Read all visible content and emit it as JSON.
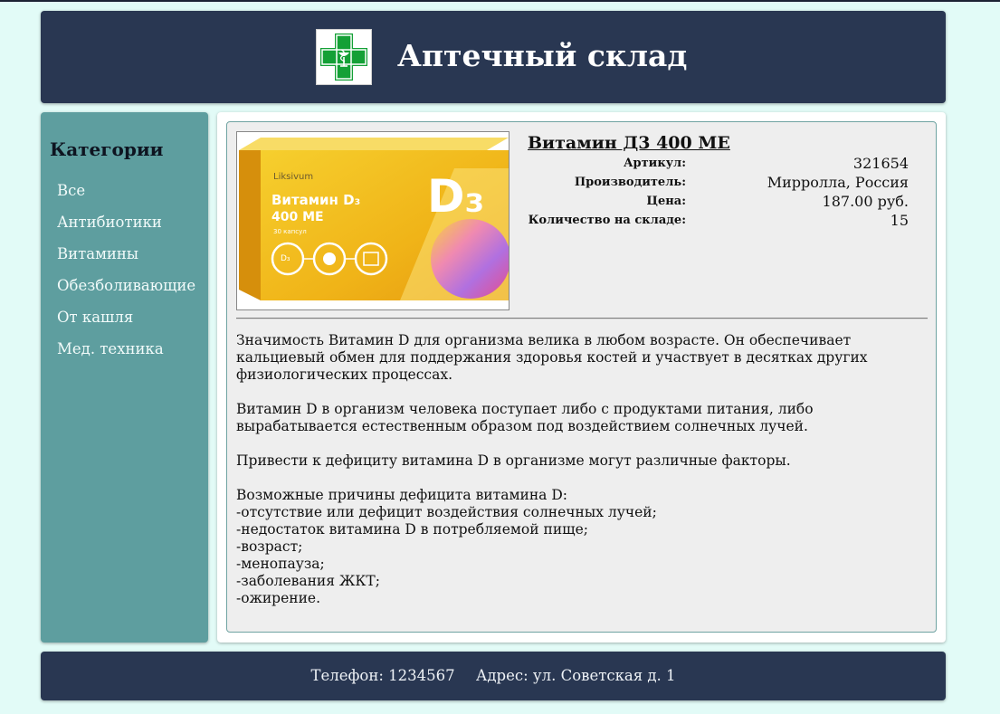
{
  "colors": {
    "page_background": "#e2fbf7",
    "header_background": "#293752",
    "sidebar_background": "#5e9e9f",
    "card_border": "#6fa3a2",
    "logo_cross": "#14a036"
  },
  "header": {
    "logo_icon": "pharmacy-cross-icon",
    "title": "Аптечный склад"
  },
  "sidebar": {
    "heading": "Категории",
    "items": [
      {
        "label": "Все"
      },
      {
        "label": "Антибиотики"
      },
      {
        "label": "Витамины"
      },
      {
        "label": "Обезболивающие"
      },
      {
        "label": "От кашля"
      },
      {
        "label": "Мед. техника"
      }
    ]
  },
  "product": {
    "image": {
      "brand": "Liksivum",
      "name_line1": "Витамин D₃",
      "name_line2": "400 МЕ",
      "count": "30 капсул",
      "big_mark": "D₃",
      "circle_label": "D₃"
    },
    "title": "Витамин Д3 400 МЕ",
    "specs": [
      {
        "label": "Артикул:",
        "value": "321654"
      },
      {
        "label": "Производитель:",
        "value": "Мирролла, Россия"
      },
      {
        "label": "Цена:",
        "value": "187.00 руб."
      },
      {
        "label": "Количество на складе:",
        "value": "15"
      }
    ],
    "description": "Значимость Витамин D для организма велика в любом возрасте. Он обеспечивает кальциевый обмен для поддержания здоровья костей и участвует в десятках других физиологических процессах.\n\nВитамин D в организм человека поступает либо с продуктами питания, либо вырабатывается естественным образом под воздействием солнечных лучей.\n\nПривести к дефициту витамина D в организме могут различные факторы.\n\nВозможные причины дефицита витамина D:\n-отсутствие или дефицит воздействия солнечных лучей;\n-недостаток витамина D в потребляемой пище;\n-возраст;\n-менопауза;\n-заболевания ЖКТ;\n-ожирение."
  },
  "footer": {
    "phone_label": "Телефон:",
    "phone_value": "1234567",
    "address_label": "Адрес:",
    "address_value": "ул. Советская д. 1"
  }
}
